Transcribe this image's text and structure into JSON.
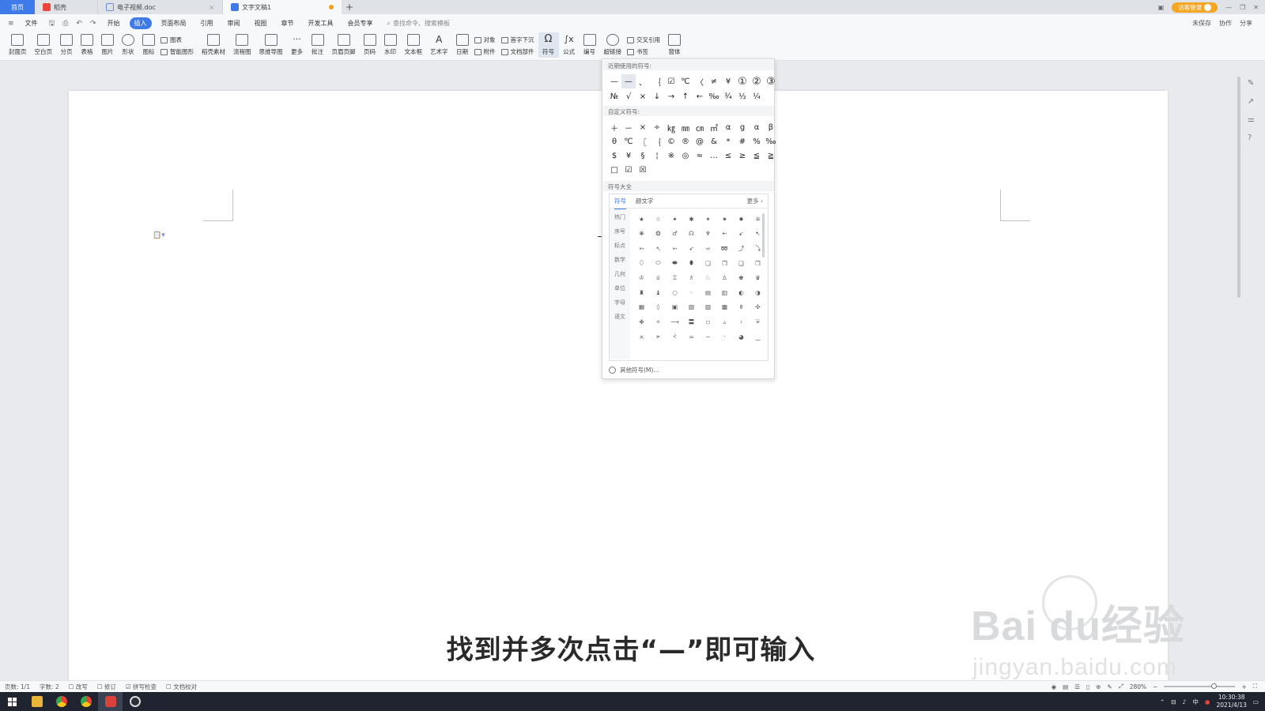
{
  "tabs": {
    "home": "首页",
    "docer": "稻壳",
    "file": "电子视频.doc",
    "active": "文字文稿1",
    "add": "+"
  },
  "titlebar": {
    "login": "访客登录"
  },
  "menu": {
    "file": "文件",
    "items": [
      "开始",
      "插入",
      "页面布局",
      "引用",
      "审阅",
      "视图",
      "章节",
      "开发工具",
      "会员专享"
    ],
    "active_index": 1,
    "search_placeholder": "查找命令、搜索模板",
    "unsaved": "未保存",
    "collab": "协作",
    "share": "分享"
  },
  "ribbon": {
    "buttons": [
      "封面页",
      "空白页",
      "分页",
      "表格",
      "图片",
      "形状",
      "图标"
    ],
    "chart": "图表",
    "smart_graphic": "智能图形",
    "buttons2": [
      "稻壳素材",
      "流程图",
      "思维导图",
      "更多",
      "批注",
      "页眉页脚",
      "页码",
      "水印",
      "文本框",
      "艺术字",
      "日期"
    ],
    "object": "对象",
    "attachment": "附件",
    "dropcap": "首字下沉",
    "docparts": "文档部件",
    "symbol": "符号",
    "formula": "公式",
    "numbering": "编号",
    "hyperlink": "超链接",
    "crossref": "交叉引用",
    "bookmark": "书签",
    "form": "窗体"
  },
  "symbol_panel": {
    "recent_title": "近期使用的符号:",
    "recent_row1": [
      "—",
      "—",
      "、",
      "｛",
      "☑",
      "℃",
      "〈",
      "≠",
      "¥",
      "①",
      "②",
      "③"
    ],
    "recent_row2": [
      "№",
      "√",
      "×",
      "↓",
      "→",
      "↑",
      "←",
      "‰",
      "¾",
      "½",
      "¼"
    ],
    "custom_title": "自定义符号:",
    "custom_row1": [
      "＋",
      "－",
      "×",
      "÷",
      "㎏",
      "㎜",
      "㎝",
      "㎡",
      "α",
      "g",
      "α",
      "β"
    ],
    "custom_row2": [
      "θ",
      "℃",
      "〖",
      "｛",
      "©",
      "®",
      "@",
      "&",
      "*",
      "#",
      "%",
      "‰"
    ],
    "custom_row3": [
      "$",
      "¥",
      "§",
      "¦",
      "※",
      "◎",
      "≈",
      "…",
      "≤",
      "≥",
      "≦",
      "≧"
    ],
    "custom_row4": [
      "□",
      "☑",
      "☒"
    ],
    "library_title": "符号大全",
    "lib_tabs": [
      "符号",
      "颜文字"
    ],
    "more": "更多",
    "categories": [
      "热门",
      "序号",
      "标点",
      "数学",
      "几何",
      "单位",
      "字母",
      "语文"
    ],
    "lib_symbols": [
      "★",
      "☆",
      "✦",
      "✱",
      "✶",
      "✷",
      "✸",
      "❊",
      "❋",
      "❂",
      "♂",
      "☊",
      "♆",
      "➸",
      "➹",
      "➷",
      "➳",
      "➴",
      "➵",
      "➶",
      "➾",
      "➿",
      "⤴",
      "⤵",
      "⬯",
      "⬭",
      "⬬",
      "⬮",
      "❏",
      "❐",
      "❑",
      "❒",
      "♔",
      "♕",
      "♖",
      "♗",
      "♘",
      "♙",
      "♚",
      "♛",
      "♜",
      "♝",
      "○",
      "◦",
      "▤",
      "▥",
      "◐",
      "◑",
      "▦",
      "◊",
      "▣",
      "▧",
      "▨",
      "▩",
      "⚱",
      "✣",
      "✥",
      "✧",
      "⟶",
      "〓",
      "▫",
      "▵",
      "›",
      "⩸",
      "⨯",
      "⩺",
      "⩻",
      "≈",
      "∽",
      "⸱",
      "◕",
      "‿"
    ],
    "other": "其他符号(M)..."
  },
  "subtitle": "找到并多次点击“—”即可输入",
  "watermark": {
    "logo": "Bai du经验",
    "url": "jingyan.baidu.com"
  },
  "status": {
    "page": "页数: 1/1",
    "words": "字数: 2",
    "revise": "改写",
    "track": "修订",
    "spell": "拼写检查",
    "proof": "文档校对",
    "zoom": "280%"
  },
  "taskbar": {
    "time": "10:30:38",
    "date": "2021/4/13",
    "ime": "中"
  }
}
